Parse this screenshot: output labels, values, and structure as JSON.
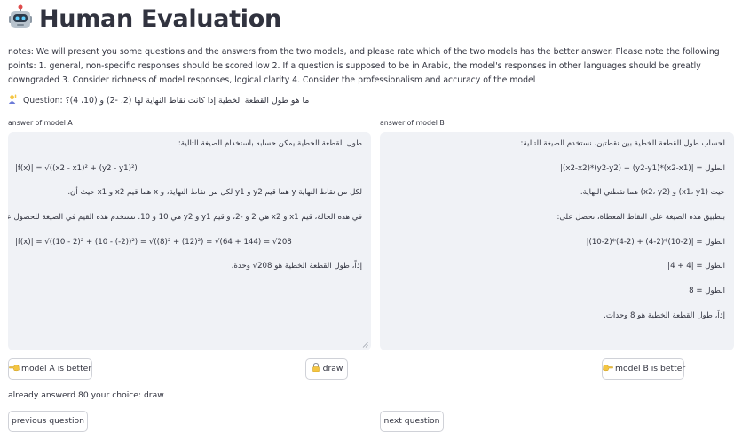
{
  "page": {
    "title": "Human Evaluation",
    "title_icon": "robot-icon",
    "notes": "notes: We will present you some questions and the answers from the two models, and please rate which of the two models has the better answer. Please note the following points: 1. general, non-specific responses should be scored low 2. If a question is supposed to be in Arabic, the model's responses in other languages should be greatly downgraded 3. Consider richness of model responses, logical clarity 4. Consider the professionalism and accuracy of the model",
    "question_prefix": "Question:",
    "question_icon": "person-raising-hand-icon",
    "question_text": "ما هو طول القطعة الخطية إذا كانت نقاط النهاية لها (2، -2) و (10، 4)؟"
  },
  "model_a": {
    "label": "answer of model A",
    "lines": [
      "طول القطعة الخطية يمكن حسابه باستخدام الصيغة التالية:",
      "|f(x)| = √((x2 - x1)² + (y2 - y1)²)",
      "لكل من نقاط النهاية y هما قيم y2 و y1 لكل من نقاط النهاية، و x هما قيم x2 و x1 حيث أن.",
      "في هذه الحالة، قيم x1 و x2 هي 2 و -2، و قيم y1 و y2 هي 10 و 10. نستخدم هذه القيم في الصيغة للحصول على:",
      "|f(x)| = √((10 - 2)² + (10 - (-2))²) = √((8)² + (12)²) = √(64 + 144) = √208",
      "إذاً، طول القطعة الخطية هو 208√ وحدة."
    ]
  },
  "model_b": {
    "label": "answer of model B",
    "lines": [
      "لحساب طول القطعة الخطية بين نقطتين، نستخدم الصيغة التالية:",
      "الطول = |(x2-x1)*(y2-y1) + (y2-y2)*(x2-x2)|",
      "حيث (x1، y1) و (x2، y2) هما نقطتي النهاية.",
      "بتطبيق هذه الصيغة على النقاط المعطاة، نحصل على:",
      "الطول = |(2-10)*(2-4) + (2-4)*(2-10)|",
      "الطول = |4 + 4|",
      "الطول = 8",
      "إذاً، طول القطعة الخطية هو 8 وحدات."
    ]
  },
  "buttons": {
    "model_a_better": "model A is better",
    "model_a_icon": "hand-pointing-left-icon",
    "draw": "draw",
    "draw_icon": "lock-icon",
    "model_b_better": "model B is better",
    "model_b_icon": "hand-pointing-right-icon",
    "previous": "previous question",
    "next": "next question"
  },
  "status": "already answerd 80 your choice: draw"
}
